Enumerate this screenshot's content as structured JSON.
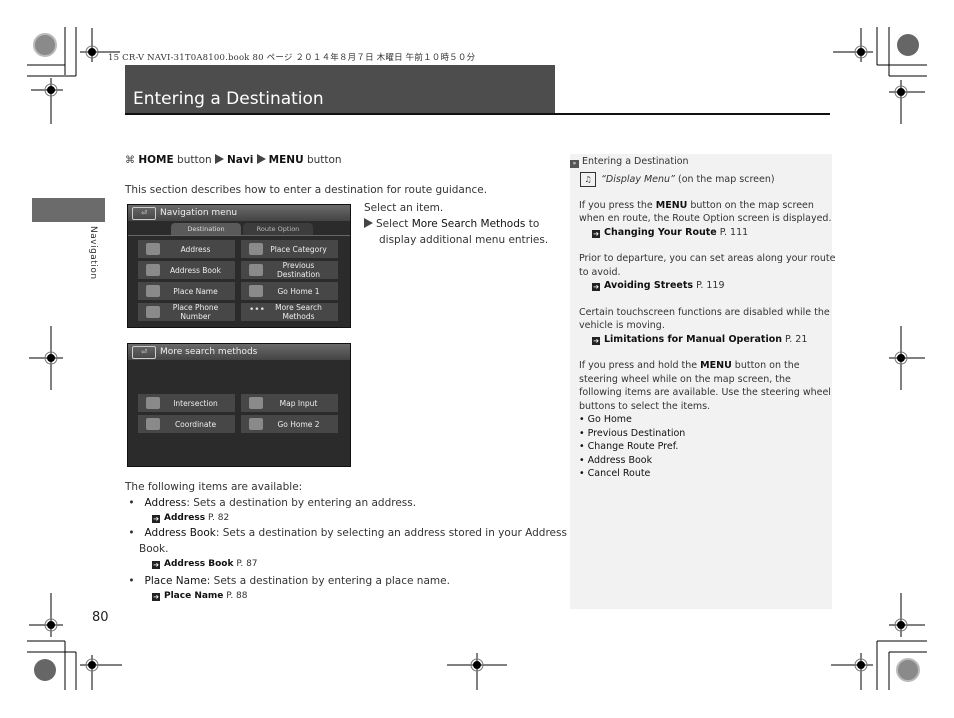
{
  "print_header": "15 CR-V NAVI-31T0A8100.book  80 ページ  ２０１４年８月７日  木曜日  午前１０時５０分",
  "section_tab": "Navigation",
  "title": "Entering a Destination",
  "nav_path": {
    "icon": "home-icon",
    "step1": "HOME",
    "step1_suffix": " button ",
    "step2": "Navi",
    "step3": "MENU",
    "step3_suffix": " button"
  },
  "intro": "This section describes how to enter a destination for route guidance.",
  "instructions": {
    "line1": "Select an item.",
    "line2_prefix": "Select ",
    "line2_bold": "More Search Methods",
    "line2_suffix": " to",
    "line3": "display additional menu entries."
  },
  "screen1": {
    "back_label": "⏎",
    "header": "Navigation menu",
    "tabs": [
      "Destination",
      "Route Option"
    ],
    "buttons": [
      {
        "label": "Address",
        "icon": "magnifier-icon"
      },
      {
        "label": "Place Category",
        "icon": "category-icon"
      },
      {
        "label": "Address Book",
        "icon": "address-book-icon"
      },
      {
        "label": "Previous Destination",
        "icon": "flag-icon"
      },
      {
        "label": "Place Name",
        "icon": "place-name-icon"
      },
      {
        "label": "Go Home 1",
        "icon": "house-icon"
      },
      {
        "label": "Place Phone Number",
        "icon": "keypad-icon"
      },
      {
        "label": "More Search Methods",
        "icon": "ellipsis-icon"
      }
    ]
  },
  "screen2": {
    "back_label": "⏎",
    "header": "More search methods",
    "buttons": [
      {
        "label": "Intersection",
        "icon": "intersection-icon"
      },
      {
        "label": "Map Input",
        "icon": "map-input-icon"
      },
      {
        "label": "Coordinate",
        "icon": "coordinate-icon"
      },
      {
        "label": "Go Home 2",
        "icon": "house-icon"
      }
    ]
  },
  "available_intro": "The following items are available:",
  "available_items": [
    {
      "term": "Address",
      "desc": ": Sets a destination by entering an address.",
      "desc2": "",
      "ref": "Address",
      "page": "P. 82"
    },
    {
      "term": "Address Book",
      "desc": ": Sets a destination by selecting an address stored in your Address",
      "desc2": "Book.",
      "ref": "Address Book",
      "page": "P. 87"
    },
    {
      "term": "Place Name",
      "desc": ": Sets a destination by entering a place name.",
      "desc2": "",
      "ref": "Place Name",
      "page": "P. 88"
    }
  ],
  "sidebar": {
    "heading": "Entering a Destination",
    "voice_cmd": "“Display Menu”",
    "voice_suffix": " (on the map screen)",
    "p1_a": "If you press the ",
    "p1_bold": "MENU",
    "p1_b": " button on the map screen",
    "p1_line2": "when en route, the Route Option screen is displayed.",
    "ref1": "Changing Your Route",
    "ref1_page": " P. 111",
    "p2_line1": "Prior to departure, you can set areas along your route",
    "p2_line2": "to avoid.",
    "ref2": "Avoiding Streets",
    "ref2_page": " P. 119",
    "p3_line1": "Certain touchscreen functions are disabled while the",
    "p3_line2": "vehicle is moving.",
    "ref3": "Limitations for Manual Operation",
    "ref3_page": " P. 21",
    "p4_a": "If you press and hold the ",
    "p4_bold": "MENU",
    "p4_b": " button on the",
    "p4_line2": "steering wheel while on the map screen, the",
    "p4_line3": "following items are available. Use the steering wheel",
    "p4_line4": "buttons to select the items.",
    "items": [
      "Go Home",
      "Previous Destination",
      "Change Route Pref.",
      "Address Book",
      "Cancel Route"
    ]
  },
  "page_number": "80"
}
